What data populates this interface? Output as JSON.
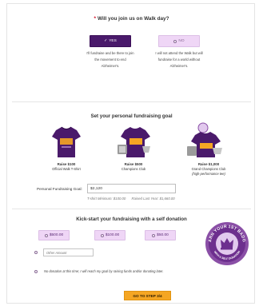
{
  "join_question": {
    "required_mark": "*",
    "text": "Will you join us on Walk day?"
  },
  "choices": {
    "yes": {
      "check": "✓",
      "label": "YES",
      "selected": true,
      "description": "I'll fundraise and be there to join the movement to end Alzheimer's."
    },
    "no": {
      "label": "NO",
      "selected": false,
      "description": "I will not attend the Walk but will fundraise for a world without Alzheimer's."
    }
  },
  "fundraising_goal": {
    "title": "Set your personal fundraising goal",
    "tiers": [
      {
        "raise": "Raise $100",
        "reward": "Official Walk T-Shirt",
        "note": ""
      },
      {
        "raise": "Raise $500",
        "reward": "Champions Club",
        "note": ""
      },
      {
        "raise": "Raise $1,000",
        "reward": "Grand Champions Club",
        "note": "(high-performance tee)"
      }
    ],
    "goal_label": "Personal Fundraising Goal:",
    "goal_value": "$2,120",
    "tshirt_minimum": "T-shirt Minimum:  $100.00",
    "raised_last_year": "Raised Last Year: $1,660.00"
  },
  "self_donation": {
    "title": "Kick-start your fundraising with a self donation",
    "amounts": [
      "$500.00",
      "$100.00",
      "$50.00"
    ],
    "other_placeholder": "Other Amount",
    "no_donation_text": "No donation at this time; I will reach my goal by raising funds and/or donating later.",
    "badge_text_top": "EARN YOUR 1ST BADGE",
    "badge_text_bottom": "WITH A SELF DONATION"
  },
  "next_button": "GO TO STEP 3/4",
  "colors": {
    "purple_dark": "#4a1a6b",
    "purple_light": "#efd6f6",
    "orange": "#f5a623",
    "badge_purple": "#8a4fa6"
  }
}
